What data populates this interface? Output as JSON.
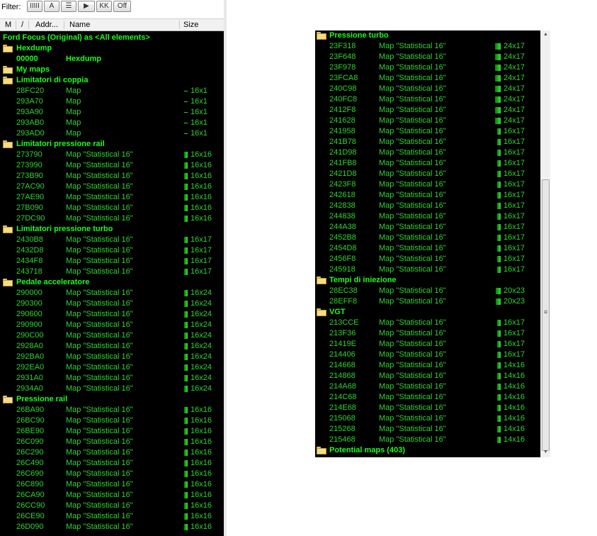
{
  "toolbar": {
    "filter_label": "Filter:",
    "buttons": [
      {
        "name": "filter-bits-button",
        "label": "IIIII"
      },
      {
        "name": "filter-text-button",
        "label": "A"
      },
      {
        "name": "filter-tree-button",
        "label": "☰"
      },
      {
        "name": "filter-flag-button",
        "label": "▶"
      },
      {
        "name": "filter-kk-button",
        "label": "KK"
      },
      {
        "name": "filter-off-button",
        "label": "Off"
      }
    ]
  },
  "columns": {
    "m": "M",
    "slash": "/",
    "address": "Addr...",
    "name": "Name",
    "size": "Size"
  },
  "left_rows": [
    {
      "t": "group",
      "label": "Ford Focus (Original) as <All elements>",
      "root": true
    },
    {
      "t": "group",
      "label": "Hexdump"
    },
    {
      "t": "hex",
      "addr": "00000",
      "name": "Hexdump"
    },
    {
      "t": "group",
      "label": "My maps"
    },
    {
      "t": "group",
      "label": "Limitatori di coppia"
    },
    {
      "t": "item",
      "addr": "28FC20",
      "name": "Map",
      "size": "16x1",
      "icon": "dash"
    },
    {
      "t": "item",
      "addr": "293A70",
      "name": "Map",
      "size": "16x1",
      "icon": "dash"
    },
    {
      "t": "item",
      "addr": "293A90",
      "name": "Map",
      "size": "16x1",
      "icon": "dash"
    },
    {
      "t": "item",
      "addr": "293AB0",
      "name": "Map",
      "size": "16x1",
      "icon": "dash"
    },
    {
      "t": "item",
      "addr": "293AD0",
      "name": "Map",
      "size": "16x1",
      "icon": "dash"
    },
    {
      "t": "group",
      "label": "Limitatori pressione rail"
    },
    {
      "t": "item",
      "addr": "273790",
      "name": "Map \"Statistical 16\"",
      "size": "16x16",
      "icon": "sq"
    },
    {
      "t": "item",
      "addr": "273990",
      "name": "Map \"Statistical 16\"",
      "size": "16x16",
      "icon": "sq"
    },
    {
      "t": "item",
      "addr": "273B90",
      "name": "Map \"Statistical 16\"",
      "size": "16x16",
      "icon": "sq"
    },
    {
      "t": "item",
      "addr": "27AC90",
      "name": "Map \"Statistical 16\"",
      "size": "16x16",
      "icon": "sq"
    },
    {
      "t": "item",
      "addr": "27AE90",
      "name": "Map \"Statistical 16\"",
      "size": "16x16",
      "icon": "sq"
    },
    {
      "t": "item",
      "addr": "27B090",
      "name": "Map \"Statistical 16\"",
      "size": "16x16",
      "icon": "sq"
    },
    {
      "t": "item",
      "addr": "27DC90",
      "name": "Map \"Statistical 16\"",
      "size": "16x16",
      "icon": "sq"
    },
    {
      "t": "group",
      "label": "Limitatori pressione turbo"
    },
    {
      "t": "item",
      "addr": "2430B8",
      "name": "Map \"Statistical 16\"",
      "size": "16x17",
      "icon": "sq"
    },
    {
      "t": "item",
      "addr": "2432D8",
      "name": "Map \"Statistical 16\"",
      "size": "16x17",
      "icon": "sq"
    },
    {
      "t": "item",
      "addr": "2434F8",
      "name": "Map \"Statistical 16\"",
      "size": "16x17",
      "icon": "sq"
    },
    {
      "t": "item",
      "addr": "243718",
      "name": "Map \"Statistical 16\"",
      "size": "16x17",
      "icon": "sq"
    },
    {
      "t": "group",
      "label": "Pedale acceleratore"
    },
    {
      "t": "item",
      "addr": "290000",
      "name": "Map \"Statistical 16\"",
      "size": "16x24",
      "icon": "sq"
    },
    {
      "t": "item",
      "addr": "290300",
      "name": "Map \"Statistical 16\"",
      "size": "16x24",
      "icon": "sq"
    },
    {
      "t": "item",
      "addr": "290600",
      "name": "Map \"Statistical 16\"",
      "size": "16x24",
      "icon": "sq"
    },
    {
      "t": "item",
      "addr": "290900",
      "name": "Map \"Statistical 16\"",
      "size": "16x24",
      "icon": "sq"
    },
    {
      "t": "item",
      "addr": "290C00",
      "name": "Map \"Statistical 16\"",
      "size": "16x24",
      "icon": "sq"
    },
    {
      "t": "item",
      "addr": "2928A0",
      "name": "Map \"Statistical 16\"",
      "size": "16x24",
      "icon": "sq"
    },
    {
      "t": "item",
      "addr": "292BA0",
      "name": "Map \"Statistical 16\"",
      "size": "16x24",
      "icon": "sq"
    },
    {
      "t": "item",
      "addr": "292EA0",
      "name": "Map \"Statistical 16\"",
      "size": "16x24",
      "icon": "sq"
    },
    {
      "t": "item",
      "addr": "2931A0",
      "name": "Map \"Statistical 16\"",
      "size": "16x24",
      "icon": "sq"
    },
    {
      "t": "item",
      "addr": "2934A0",
      "name": "Map \"Statistical 16\"",
      "size": "16x24",
      "icon": "sq"
    },
    {
      "t": "group",
      "label": "Pressione rail"
    },
    {
      "t": "item",
      "addr": "26BA90",
      "name": "Map \"Statistical 16\"",
      "size": "16x16",
      "icon": "sq"
    },
    {
      "t": "item",
      "addr": "26BC90",
      "name": "Map \"Statistical 16\"",
      "size": "16x16",
      "icon": "sq"
    },
    {
      "t": "item",
      "addr": "26BE90",
      "name": "Map \"Statistical 16\"",
      "size": "16x16",
      "icon": "sq"
    },
    {
      "t": "item",
      "addr": "26C090",
      "name": "Map \"Statistical 16\"",
      "size": "16x16",
      "icon": "sq"
    },
    {
      "t": "item",
      "addr": "26C290",
      "name": "Map \"Statistical 16\"",
      "size": "16x16",
      "icon": "sq"
    },
    {
      "t": "item",
      "addr": "26C490",
      "name": "Map \"Statistical 16\"",
      "size": "16x16",
      "icon": "sq"
    },
    {
      "t": "item",
      "addr": "26C690",
      "name": "Map \"Statistical 16\"",
      "size": "16x16",
      "icon": "sq"
    },
    {
      "t": "item",
      "addr": "26C890",
      "name": "Map \"Statistical 16\"",
      "size": "16x16",
      "icon": "sq"
    },
    {
      "t": "item",
      "addr": "26CA90",
      "name": "Map \"Statistical 16\"",
      "size": "16x16",
      "icon": "sq"
    },
    {
      "t": "item",
      "addr": "26CC90",
      "name": "Map \"Statistical 16\"",
      "size": "16x16",
      "icon": "sq"
    },
    {
      "t": "item",
      "addr": "26CE90",
      "name": "Map \"Statistical 16\"",
      "size": "16x16",
      "icon": "sq"
    },
    {
      "t": "item",
      "addr": "26D090",
      "name": "Map \"Statistical 16\"",
      "size": "16x16",
      "icon": "sq"
    }
  ],
  "right_rows": [
    {
      "t": "group",
      "label": "Pressione turbo"
    },
    {
      "t": "item",
      "addr": "23F318",
      "name": "Map \"Statistical 16\"",
      "size": "24x17",
      "icon": "sq"
    },
    {
      "t": "item",
      "addr": "23F648",
      "name": "Map \"Statistical 16\"",
      "size": "24x17",
      "icon": "sq"
    },
    {
      "t": "item",
      "addr": "23F978",
      "name": "Map \"Statistical 16\"",
      "size": "24x17",
      "icon": "sq"
    },
    {
      "t": "item",
      "addr": "23FCA8",
      "name": "Map \"Statistical 16\"",
      "size": "24x17",
      "icon": "sq"
    },
    {
      "t": "item",
      "addr": "240C98",
      "name": "Map \"Statistical 16\"",
      "size": "24x17",
      "icon": "sq"
    },
    {
      "t": "item",
      "addr": "240FC8",
      "name": "Map \"Statistical 16\"",
      "size": "24x17",
      "icon": "sq"
    },
    {
      "t": "item",
      "addr": "2412F8",
      "name": "Map \"Statistical 16\"",
      "size": "24x17",
      "icon": "sq"
    },
    {
      "t": "item",
      "addr": "241628",
      "name": "Map \"Statistical 16\"",
      "size": "24x17",
      "icon": "sq"
    },
    {
      "t": "item",
      "addr": "241958",
      "name": "Map \"Statistical 16\"",
      "size": "16x17",
      "icon": "sq"
    },
    {
      "t": "item",
      "addr": "241B78",
      "name": "Map \"Statistical 16\"",
      "size": "16x17",
      "icon": "sq"
    },
    {
      "t": "item",
      "addr": "241D98",
      "name": "Map \"Statistical 16\"",
      "size": "16x17",
      "icon": "sq"
    },
    {
      "t": "item",
      "addr": "241FB8",
      "name": "Map \"Statistical 16\"",
      "size": "16x17",
      "icon": "sq"
    },
    {
      "t": "item",
      "addr": "2421D8",
      "name": "Map \"Statistical 16\"",
      "size": "16x17",
      "icon": "sq"
    },
    {
      "t": "item",
      "addr": "2423F8",
      "name": "Map \"Statistical 16\"",
      "size": "16x17",
      "icon": "sq"
    },
    {
      "t": "item",
      "addr": "242618",
      "name": "Map \"Statistical 16\"",
      "size": "16x17",
      "icon": "sq"
    },
    {
      "t": "item",
      "addr": "242838",
      "name": "Map \"Statistical 16\"",
      "size": "16x17",
      "icon": "sq"
    },
    {
      "t": "item",
      "addr": "244838",
      "name": "Map \"Statistical 16\"",
      "size": "16x17",
      "icon": "sq"
    },
    {
      "t": "item",
      "addr": "244A38",
      "name": "Map \"Statistical 16\"",
      "size": "16x17",
      "icon": "sq"
    },
    {
      "t": "item",
      "addr": "2452B8",
      "name": "Map \"Statistical 16\"",
      "size": "16x17",
      "icon": "sq"
    },
    {
      "t": "item",
      "addr": "2454D8",
      "name": "Map \"Statistical 16\"",
      "size": "16x17",
      "icon": "sq"
    },
    {
      "t": "item",
      "addr": "2456F8",
      "name": "Map \"Statistical 16\"",
      "size": "16x17",
      "icon": "sq"
    },
    {
      "t": "item",
      "addr": "245918",
      "name": "Map \"Statistical 16\"",
      "size": "16x17",
      "icon": "sq"
    },
    {
      "t": "group",
      "label": "Tempi di iniezione"
    },
    {
      "t": "item",
      "addr": "28EC38",
      "name": "Map \"Statistical 16\"",
      "size": "20x23",
      "icon": "sq"
    },
    {
      "t": "item",
      "addr": "28EFF8",
      "name": "Map \"Statistical 16\"",
      "size": "20x23",
      "icon": "sq"
    },
    {
      "t": "group",
      "label": "VGT"
    },
    {
      "t": "item",
      "addr": "213CCE",
      "name": "Map \"Statistical 16\"",
      "size": "16x17",
      "icon": "sq"
    },
    {
      "t": "item",
      "addr": "213F36",
      "name": "Map \"Statistical 16\"",
      "size": "16x17",
      "icon": "sq"
    },
    {
      "t": "item",
      "addr": "21419E",
      "name": "Map \"Statistical 16\"",
      "size": "16x17",
      "icon": "sq"
    },
    {
      "t": "item",
      "addr": "214406",
      "name": "Map \"Statistical 16\"",
      "size": "16x17",
      "icon": "sq"
    },
    {
      "t": "item",
      "addr": "214668",
      "name": "Map \"Statistical 16\"",
      "size": "14x16",
      "icon": "sq"
    },
    {
      "t": "item",
      "addr": "214868",
      "name": "Map \"Statistical 16\"",
      "size": "14x16",
      "icon": "sq"
    },
    {
      "t": "item",
      "addr": "214A68",
      "name": "Map \"Statistical 16\"",
      "size": "14x16",
      "icon": "sq"
    },
    {
      "t": "item",
      "addr": "214C68",
      "name": "Map \"Statistical 16\"",
      "size": "14x16",
      "icon": "sq"
    },
    {
      "t": "item",
      "addr": "214E68",
      "name": "Map \"Statistical 16\"",
      "size": "14x16",
      "icon": "sq"
    },
    {
      "t": "item",
      "addr": "215068",
      "name": "Map \"Statistical 16\"",
      "size": "14x16",
      "icon": "sq"
    },
    {
      "t": "item",
      "addr": "215268",
      "name": "Map \"Statistical 16\"",
      "size": "14x16",
      "icon": "sq"
    },
    {
      "t": "item",
      "addr": "215468",
      "name": "Map \"Statistical 16\"",
      "size": "14x16",
      "icon": "sq"
    },
    {
      "t": "group",
      "label": "Potential maps (403)"
    }
  ],
  "colors": {
    "pane_bg": "#000000",
    "group_text": "#1aff1a",
    "item_text": "#2fd42f",
    "folder": "#f5dc83"
  },
  "icons": {
    "group": "folder-icon",
    "map": "map-icon",
    "scrollbar_grip": "scroll-grip-icon"
  },
  "scrollbar": {
    "up": "▲",
    "down": "▼",
    "grip": "≡"
  }
}
